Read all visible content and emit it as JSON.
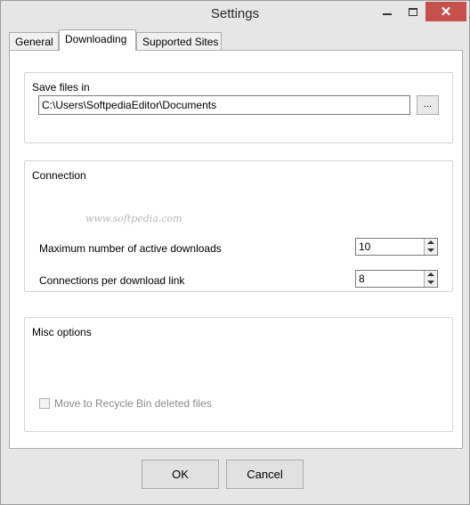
{
  "window": {
    "title": "Settings"
  },
  "tabs": [
    {
      "label": "General"
    },
    {
      "label": "Downloading"
    },
    {
      "label": "Supported Sites"
    }
  ],
  "save_files": {
    "group_title": "Save files in",
    "path_value": "C:\\Users\\SoftpediaEditor\\Documents",
    "browse_label": "..."
  },
  "connection": {
    "group_title": "Connection",
    "max_active_label": "Maximum number of active downloads",
    "max_active_value": "10",
    "per_link_label": "Connections per download link",
    "per_link_value": "8"
  },
  "misc": {
    "group_title": "Misc options",
    "recycle_label": "Move to Recycle Bin deleted files",
    "recycle_checked": false
  },
  "footer": {
    "ok_label": "OK",
    "cancel_label": "Cancel"
  },
  "watermark": "www.softpedia.com"
}
